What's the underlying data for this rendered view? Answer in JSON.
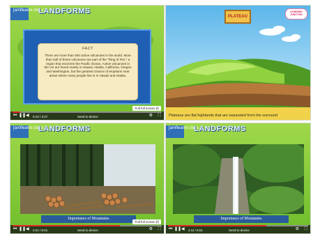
{
  "panel1": {
    "site": "[amfleams class",
    "title": "LANDFORMS",
    "fact_title": "FACT",
    "fact_body": "There are more than 600 active volcanoes in the world. More than half of these volcanoes are part of the \"Ring of Fire,\" a region that encircles the Pacific Ocean. Active volcanoes in the US are found mainly in Hawaii, Alaska, California, Oregon and Washington, but the greatest chance of eruptions near areas where many people live is in Hawaii and Alaska.",
    "fullscreen_label": "Full full screen (f)",
    "controls": {
      "time": "0:10 / 3:27",
      "center": "Send to device"
    },
    "progress": 0.05
  },
  "panel2": {
    "sign": "PLATEAU",
    "logo": "LEARNING JUNCTION",
    "caption": "Plateaus are flat highlands that are separated from the surround"
  },
  "panel3": {
    "site": "[amfleams class",
    "title": "LANDFORMS",
    "caption": "Importance of Mountains",
    "fullscreen_label": "Full full screen (f)",
    "controls": {
      "time": "4:21 / 6:01",
      "center": "Send to device"
    },
    "progress": 0.72
  },
  "panel4": {
    "site": "[amfleams class",
    "title": "LANDFORMS",
    "caption": "Importance of Mountains",
    "controls": {
      "time": "4:11 / 6:01",
      "center": "Send to device"
    },
    "progress": 0.7
  },
  "colors": {
    "accent": "#e3242b",
    "frame_blue": "#1f5fb4",
    "grass": "#72c02e"
  }
}
